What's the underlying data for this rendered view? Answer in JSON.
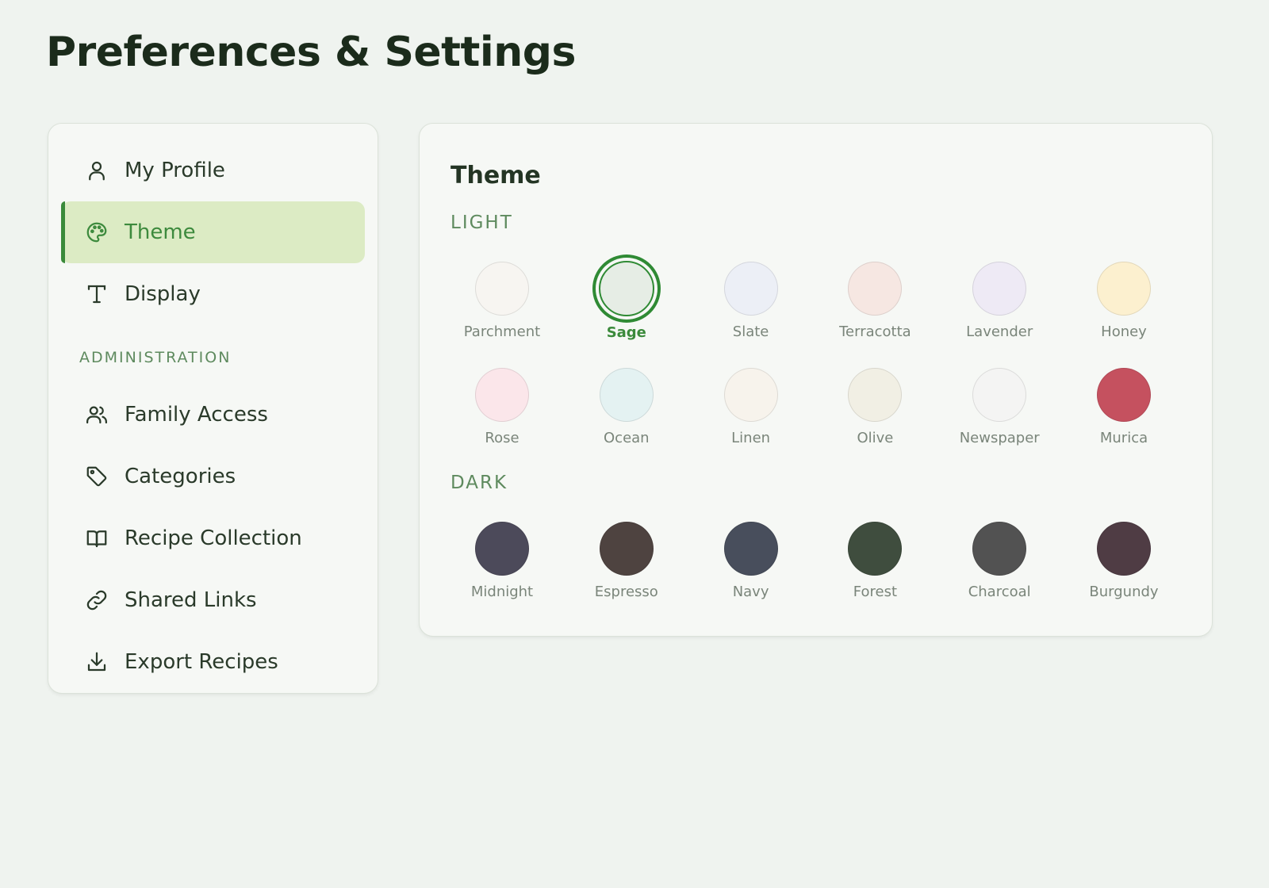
{
  "page": {
    "title": "Preferences & Settings"
  },
  "sidebar": {
    "items": [
      {
        "label": "My Profile",
        "icon": "user-icon"
      },
      {
        "label": "Theme",
        "icon": "palette-icon",
        "active": true
      },
      {
        "label": "Display",
        "icon": "text-icon"
      }
    ],
    "section_label": "ADMINISTRATION",
    "admin_items": [
      {
        "label": "Family Access",
        "icon": "users-icon"
      },
      {
        "label": "Categories",
        "icon": "tag-icon"
      },
      {
        "label": "Recipe Collection",
        "icon": "book-icon"
      },
      {
        "label": "Shared Links",
        "icon": "link-icon"
      },
      {
        "label": "Export Recipes",
        "icon": "download-icon"
      }
    ]
  },
  "theme_panel": {
    "title": "Theme",
    "light_label": "LIGHT",
    "dark_label": "DARK",
    "selected": "Sage",
    "light": [
      {
        "name": "Parchment",
        "color": "#f7f5f1"
      },
      {
        "name": "Sage",
        "color": "#e6ede5"
      },
      {
        "name": "Slate",
        "color": "#eceff6"
      },
      {
        "name": "Terracotta",
        "color": "#f6e7e2"
      },
      {
        "name": "Lavender",
        "color": "#eeeaf5"
      },
      {
        "name": "Honey",
        "color": "#fcf0cf"
      },
      {
        "name": "Rose",
        "color": "#fbe6ea"
      },
      {
        "name": "Ocean",
        "color": "#e4f2f2"
      },
      {
        "name": "Linen",
        "color": "#f7f3ec"
      },
      {
        "name": "Olive",
        "color": "#f1efe4"
      },
      {
        "name": "Newspaper",
        "color": "#f4f4f3"
      },
      {
        "name": "Murica",
        "color": "#c5515f"
      }
    ],
    "dark": [
      {
        "name": "Midnight",
        "color": "#4c4a5a"
      },
      {
        "name": "Espresso",
        "color": "#4e4340"
      },
      {
        "name": "Navy",
        "color": "#484e5c"
      },
      {
        "name": "Forest",
        "color": "#3f4d3e"
      },
      {
        "name": "Charcoal",
        "color": "#525252"
      },
      {
        "name": "Burgundy",
        "color": "#4f3c44"
      }
    ]
  },
  "colors": {
    "accent": "#3a8a3a",
    "active_bg": "#dcebc4"
  }
}
